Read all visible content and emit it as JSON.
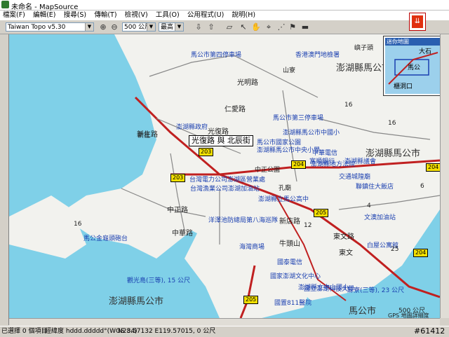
{
  "window": {
    "title": "未命名 - MapSource"
  },
  "menu": [
    "檔案(F)",
    "編輯(E)",
    "搜尋(S)",
    "傳輸(T)",
    "檢視(V)",
    "工具(O)",
    "公用程式(U)",
    "說明(H)"
  ],
  "toolbar": {
    "product": "Taiwan Topo v5.30",
    "scale": "500 公尺",
    "detail": "最高"
  },
  "minimap": {
    "title": "迷你地圖",
    "labels": [
      "大石",
      "馬公",
      "櫃洞口"
    ],
    "shields": [
      "204",
      "203",
      "201"
    ]
  },
  "map": {
    "big_labels": [
      "澎湖縣馬公市",
      "澎湖縣馬公市",
      "澎湖縣馬公市",
      "馬公市",
      "嶼子頭"
    ],
    "roads": [
      "光復路",
      "光明路",
      "仁愛路",
      "新生路",
      "中正路",
      "新店路",
      "中華路",
      "東文路",
      "牛頭山",
      "東文"
    ],
    "places": [
      "山寮",
      "新社",
      "馬公市",
      "重光",
      "中正公園",
      "孔廟",
      "交通城隍廟",
      "西衛",
      "後寮",
      "文澳",
      "東衛里"
    ],
    "pois": [
      "馬公市第四停車場",
      "香港澳門地檢署",
      "馬公市第三停車場",
      "澎湖縣馬公市中國小",
      "馬公市國家公園",
      "澎湖縣馬公市中央小學",
      "台灣電力公司澎湖區營業處",
      "澎湖縣政府",
      "中華電信",
      "富順銀行",
      "澎湖縣地方法院",
      "澎湖縣立馬公高中",
      "台灣漁業公司澎湖加油站",
      "洋澤池防總局第八海巡隊",
      "海灣商場",
      "國泰電信",
      "國家澎湖文化中心",
      "觀光島(三等), 15 公尺",
      "馬公金龜頭砲台",
      "鯨寮(三等), 23 公尺",
      "國立澎湖科技大學",
      "澎湖縣立中山國小",
      "國置811醫院",
      "文澳加油站",
      "白屋公寓館",
      "聯鎮住大飯店",
      "交通城隍廟",
      "澎湖縣議會"
    ],
    "spot_heights": [
      "16",
      "16",
      "16",
      "6",
      "4",
      "12",
      "25",
      "16",
      "15",
      "16",
      "16",
      "16",
      "16",
      "6"
    ],
    "shields": [
      "203",
      "203",
      "204",
      "204",
      "204",
      "205",
      "205",
      "204",
      "205",
      "204"
    ],
    "tooltip": "光復路 與 北辰街",
    "scale_label": "500 公尺",
    "credit": "GPS 地圖詳細度"
  },
  "status": {
    "selection": "已選擇 0 個項目",
    "datum_label": "經緯度 hddd.ddddd°(WGS 84)",
    "coords": "N23.57132 E119.57015, 0 公尺"
  },
  "watermark": "#61412"
}
